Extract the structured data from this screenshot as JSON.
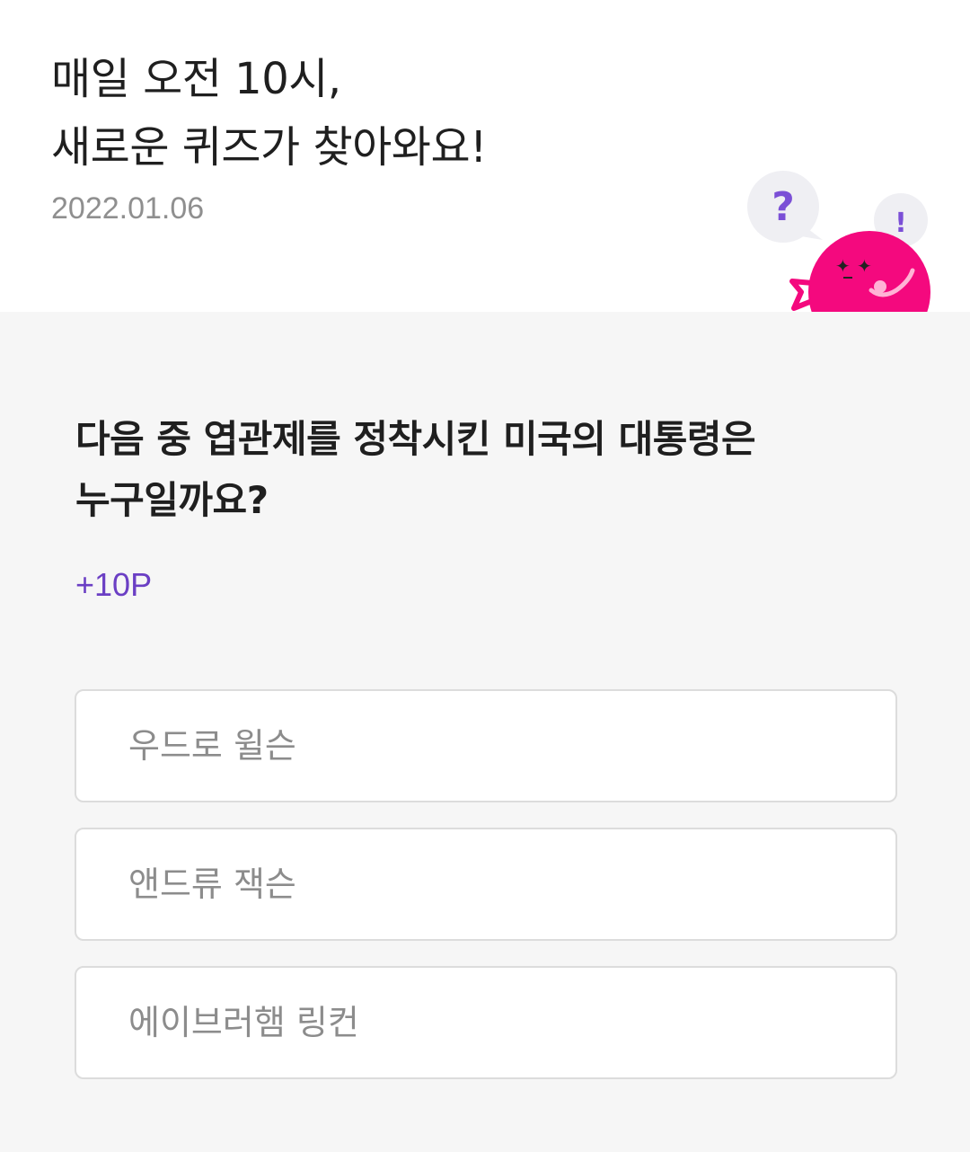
{
  "header": {
    "headline_line1": "매일 오전 10시,",
    "headline_line2": "새로운 퀴즈가 찾아와요!",
    "date": "2022.01.06",
    "mascot": {
      "bubble_question": "?",
      "bubble_exclaim": "!",
      "body_color": "#f4097e",
      "accent_color": "#7b4fd6"
    }
  },
  "quiz": {
    "question_line1": "다음 중 엽관제를 정착시킨 미국의 대통령은",
    "question_line2": "누구일까요?",
    "points": "+10P",
    "options": [
      {
        "label": "우드로 윌슨"
      },
      {
        "label": "앤드류 잭슨"
      },
      {
        "label": "에이브러햄 링컨"
      }
    ]
  },
  "colors": {
    "background": "#f6f6f6",
    "points_color": "#6b3fc4",
    "option_border": "#dcdcdc"
  }
}
